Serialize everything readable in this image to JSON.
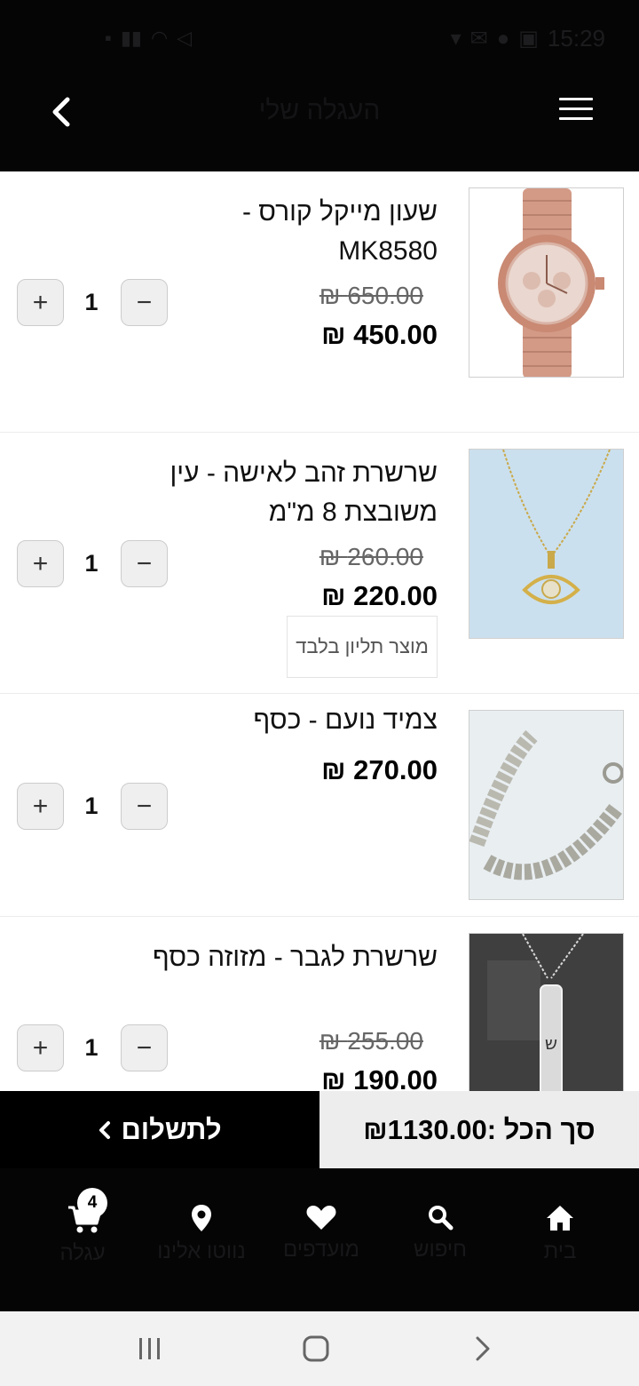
{
  "status_bar": {
    "time": "15:29"
  },
  "header": {
    "title": "העגלה שלי"
  },
  "items": [
    {
      "name": "שעון מייקל קורס - MK8580",
      "old_price": "650.00 ₪",
      "price": "450.00 ₪",
      "quantity": "1",
      "minus": "−",
      "plus": "+"
    },
    {
      "name": "שרשרת זהב לאישה - עין משובצת 8 מ\"מ",
      "old_price": "260.00 ₪",
      "price": "220.00 ₪",
      "note": "מוצר תליון בלבד",
      "quantity": "1",
      "minus": "−",
      "plus": "+"
    },
    {
      "name": "צמיד נועם - כסף",
      "price": "270.00 ₪",
      "quantity": "1",
      "minus": "−",
      "plus": "+"
    },
    {
      "name": "שרשרת לגבר - מזוזה כסף",
      "old_price": "255.00 ₪",
      "price": "190.00 ₪",
      "quantity": "1",
      "minus": "−",
      "plus": "+"
    }
  ],
  "checkout": {
    "pay_label": "לתשלום",
    "total_label": "סך הכל :₪1130.00"
  },
  "bottom_nav": [
    {
      "label": "עגלה",
      "icon": "cart-icon",
      "badge": "4"
    },
    {
      "label": "נווטו אלינו",
      "icon": "location-pin-icon"
    },
    {
      "label": "מועדפים",
      "icon": "heart-icon"
    },
    {
      "label": "חיפוש",
      "icon": "search-icon"
    },
    {
      "label": "בית",
      "icon": "home-icon"
    }
  ],
  "colors": {
    "header_bg": "#050506",
    "pay_bg": "#000000",
    "total_bg": "#ededed"
  }
}
